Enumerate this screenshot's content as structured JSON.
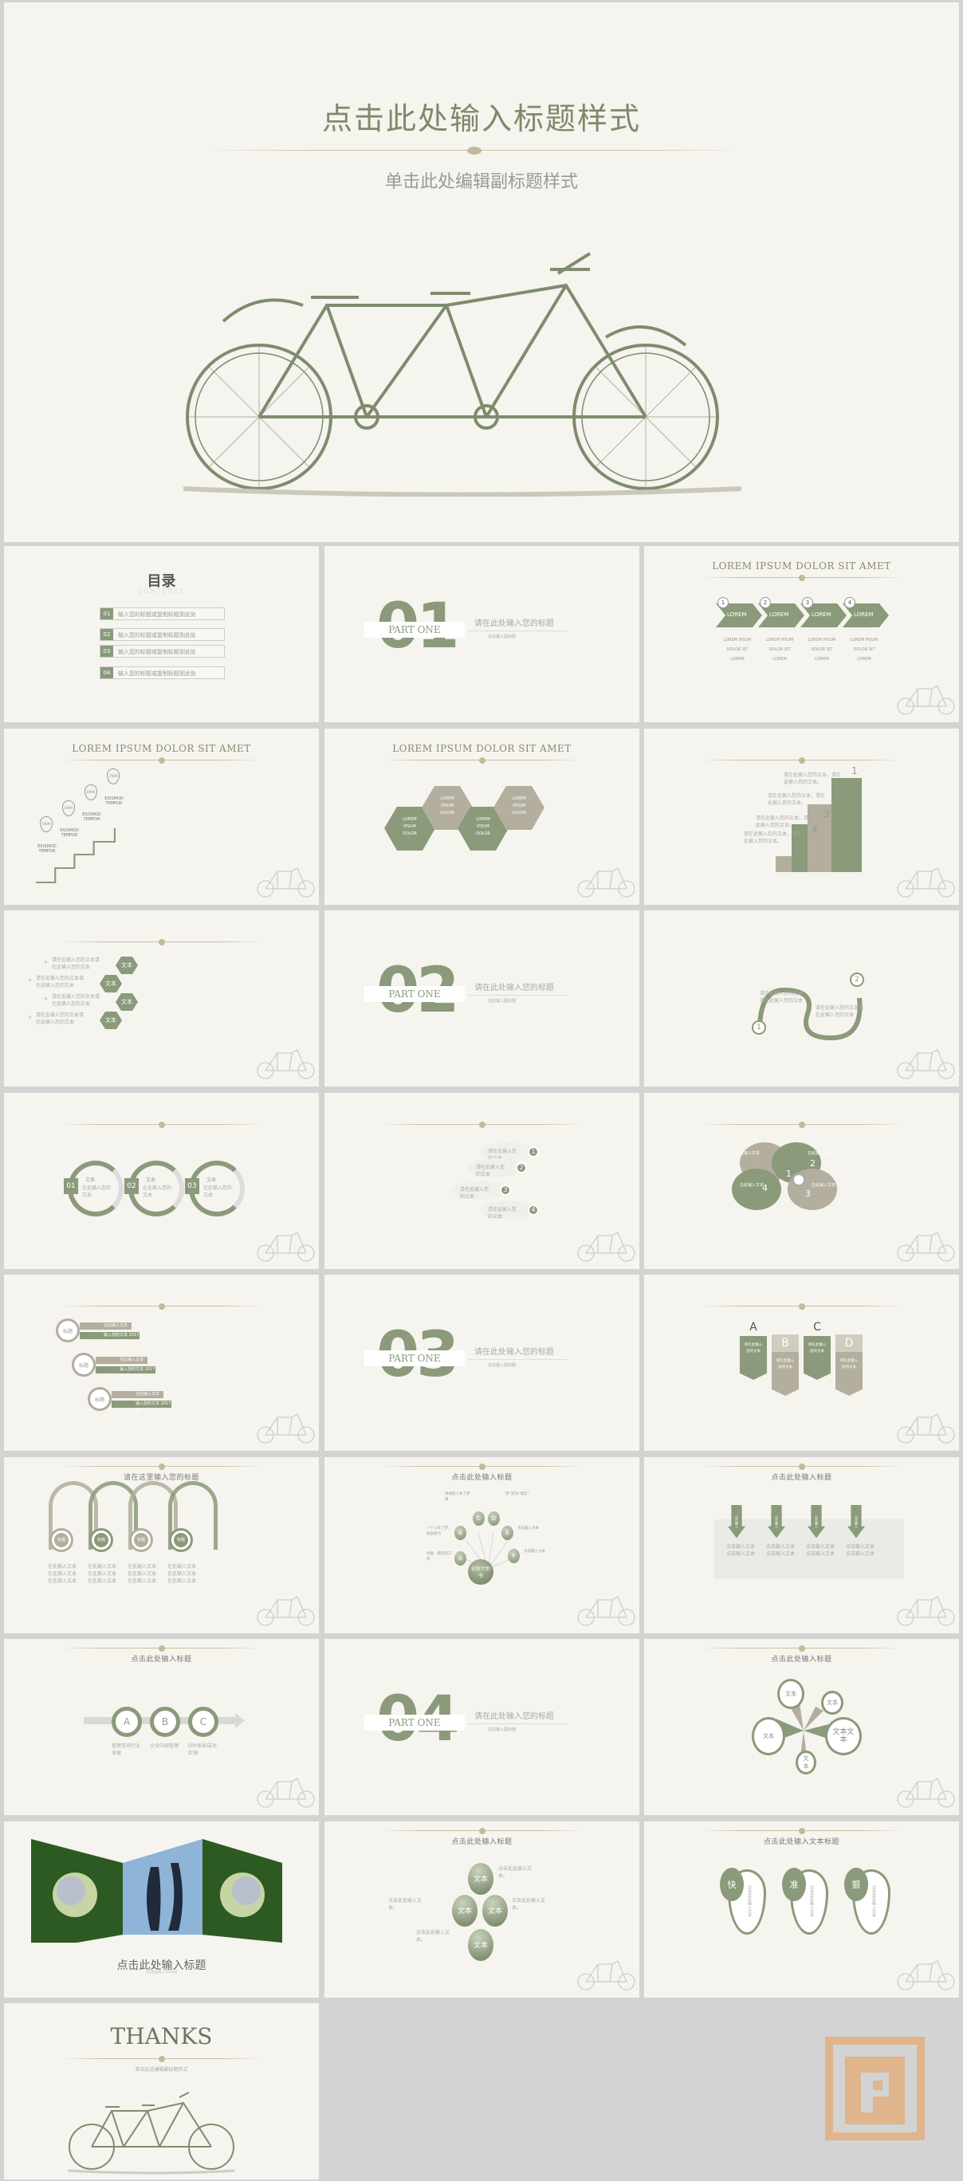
{
  "colors": {
    "green": "#8a9a7a",
    "taupe": "#b3ae9d",
    "bg": "#f6f4ee",
    "page": "#d3d3d3",
    "logo": "#e0b48c"
  },
  "hero": {
    "title": "点击此处输入标题样式",
    "subtitle": "单击此处编辑副标题样式"
  },
  "slides": [
    {
      "type": "toc",
      "title": "目录",
      "subtitle": "CONTENTS",
      "items": [
        {
          "num": "01",
          "text": "输入您的标题或复制标题到此处"
        },
        {
          "num": "02",
          "text": "输入您的标题或复制标题到此处"
        },
        {
          "num": "03",
          "text": "输入您的标题或复制标题到此处"
        },
        {
          "num": "04",
          "text": "输入您的标题或复制标题到此处"
        }
      ]
    },
    {
      "type": "section",
      "num": "01",
      "part": "PART ONE",
      "title": "请在此处输入您的标题",
      "subtitle": "在此输入副标题"
    },
    {
      "type": "chevrons",
      "title": "LOREM IPSUM DOLOR SIT AMET",
      "items": [
        {
          "num": "1",
          "label": "LOREM",
          "caption": [
            "LOREM IPSUM",
            "DOLOR SIT",
            "LOREM"
          ]
        },
        {
          "num": "2",
          "label": "LOREM",
          "caption": [
            "LOREM IPSUM",
            "DOLOR SIT",
            "LOREM"
          ]
        },
        {
          "num": "3",
          "label": "LOREM",
          "caption": [
            "LOREM IPSUM",
            "DOLOR SIT",
            "LOREM"
          ]
        },
        {
          "num": "4",
          "label": "LOREM",
          "caption": [
            "LOREM IPSUM",
            "DOLOR SIT",
            "LOREM"
          ]
        }
      ]
    },
    {
      "type": "stairs",
      "title": "LOREM IPSUM DOLOR SIT AMET",
      "items": [
        {
          "pin": "ENIM",
          "text": "EIUSMOD TEMPOR"
        },
        {
          "pin": "ENIM",
          "text": "EIUSMOD TEMPOR"
        },
        {
          "pin": "ENIM",
          "text": "EIUSMOD TEMPOR"
        },
        {
          "pin": "ENIM",
          "text": "EIUSMOD TEMPOR"
        }
      ]
    },
    {
      "type": "hexes",
      "title": "LOREM IPSUM DOLOR SIT AMET",
      "items": [
        "LOREM IPSUM DOLOR",
        "LOREM IPSUM DOLOR",
        "LOREM IPSUM DOLOR",
        "LOREM IPSUM DOLOR"
      ]
    },
    {
      "type": "hands",
      "items": [
        {
          "num": "1",
          "text": "请在此输入您的文本，请在此输入您的文本。"
        },
        {
          "num": "2",
          "text": "请在此输入您的文本，请在此输入您的文本。"
        },
        {
          "num": "3",
          "text": "请在此输入您的文本，请在此输入您的文本。"
        },
        {
          "num": "4",
          "text": "请在此输入您的文本，请在此输入您的文本。"
        }
      ]
    },
    {
      "type": "hexlist",
      "items": [
        {
          "label": "文本",
          "text": "请在此输入您的文本请在此输入您的文本"
        },
        {
          "label": "文本",
          "text": "请在此输入您的文本请在此输入您的文本"
        },
        {
          "label": "文本",
          "text": "请在此输入您的文本请在此输入您的文本"
        },
        {
          "label": "文本",
          "text": "请在此输入您的文本请在此输入您的文本"
        }
      ]
    },
    {
      "type": "section",
      "num": "02",
      "part": "PART ONE",
      "title": "请在此处输入您的标题",
      "subtitle": "在此输入副标题"
    },
    {
      "type": "curve",
      "items": [
        {
          "num": "1",
          "text": "请在此输入您的文本请在此输入您的文本"
        },
        {
          "num": "2",
          "text": "请在此输入您的文本请在此输入您的文本"
        }
      ]
    },
    {
      "type": "rings",
      "items": [
        {
          "num": "01",
          "label": "文本",
          "text": "在此输入您的文本"
        },
        {
          "num": "02",
          "label": "文本",
          "text": "在此输入您的文本"
        },
        {
          "num": "03",
          "label": "文本",
          "text": "在此输入您的文本"
        }
      ]
    },
    {
      "type": "bubbles",
      "items": [
        {
          "num": "1",
          "text": "请在此输入您的文本"
        },
        {
          "num": "2",
          "text": "请在此输入您的文本"
        },
        {
          "num": "3",
          "text": "请在此输入您的文本"
        },
        {
          "num": "4",
          "text": "请在此输入您的文本"
        }
      ]
    },
    {
      "type": "clover",
      "items": [
        {
          "num": "1",
          "text": "在此输入文本"
        },
        {
          "num": "2",
          "text": "在此输入文本"
        },
        {
          "num": "3",
          "text": "在此输入文本"
        },
        {
          "num": "4",
          "text": "在此输入文本"
        }
      ]
    },
    {
      "type": "pills",
      "items": [
        {
          "label": "标题",
          "a": "在此输入文本",
          "b": "输入您的文本 2017年"
        },
        {
          "label": "标题",
          "a": "在此输入文本",
          "b": "输入您的文本 2017年"
        },
        {
          "label": "标题",
          "a": "在此输入文本",
          "b": "输入您的文本 2017年"
        }
      ]
    },
    {
      "type": "section",
      "num": "03",
      "part": "PART ONE",
      "title": "请在此处输入您的标题",
      "subtitle": "在此输入副标题"
    },
    {
      "type": "ribbons",
      "items": [
        {
          "letter": "A",
          "text": "请在此输入您的文本"
        },
        {
          "letter": "B",
          "text": "请在此输入您的文本"
        },
        {
          "letter": "C",
          "text": "请在此输入您的文本"
        },
        {
          "letter": "D",
          "text": "请在此输入您的文本"
        }
      ]
    },
    {
      "type": "arcs",
      "title": "请在这里输入您的标题",
      "items": [
        {
          "label": "标题",
          "text": [
            "在此输入文本",
            "在此输入文本",
            "在此输入文本"
          ]
        },
        {
          "label": "标题",
          "text": [
            "在此输入文本",
            "在此输入文本",
            "在此输入文本"
          ]
        },
        {
          "label": "标题",
          "text": [
            "在此输入文本",
            "在此输入文本",
            "在此输入文本"
          ]
        },
        {
          "label": "标题",
          "text": [
            "在此输入文本",
            "在此输入文本",
            "在此输入文本"
          ]
        }
      ]
    },
    {
      "type": "radial",
      "title": "点击此处输入标题",
      "center": "创业计划书",
      "items": [
        {
          "letter": "A",
          "text": "优质、稳定的工作"
        },
        {
          "letter": "B",
          "text": "一个人有了梦，就会努力"
        },
        {
          "letter": "C",
          "text": "单纯的人有了梦想"
        },
        {
          "letter": "D",
          "text": "“梦”成为“现实”"
        },
        {
          "letter": "E",
          "text": "点击输入文本"
        },
        {
          "letter": "F",
          "text": "点击输入文本"
        }
      ]
    },
    {
      "type": "downarrows",
      "title": "点击此处输入标题",
      "items": [
        {
          "label": "点击输入",
          "text": "点击输入文本"
        },
        {
          "label": "点击输入",
          "text": "点击输入文本"
        },
        {
          "label": "点击输入",
          "text": "点击输入文本"
        },
        {
          "label": "点击输入",
          "text": "点击输入文本"
        }
      ]
    },
    {
      "type": "abc",
      "title": "点击此处输入标题",
      "items": [
        {
          "letter": "A",
          "text": "管理咨询行业发展"
        },
        {
          "letter": "B",
          "text": "企业内部管理"
        },
        {
          "letter": "C",
          "text": "ERP系统成功实施"
        }
      ]
    },
    {
      "type": "section",
      "num": "04",
      "part": "PART ONE",
      "title": "请在此处输入您的标题",
      "subtitle": "在此输入副标题"
    },
    {
      "type": "petals",
      "title": "点击此处输入标题",
      "items": [
        "文本",
        "文本",
        "文本",
        "文本文本",
        "文本"
      ]
    },
    {
      "type": "photo",
      "title": "点击此处输入标题",
      "subtitle": "点击此处输入文本内容"
    },
    {
      "type": "orbs",
      "title": "点击此处输入标题",
      "items": [
        {
          "label": "文本",
          "text": "点击此处输入文本。"
        },
        {
          "label": "文本",
          "text": "点击此处输入文本。"
        },
        {
          "label": "文本",
          "text": "点击此处输入文本。"
        },
        {
          "label": "文本",
          "text": "点击此处输入文本。"
        }
      ]
    },
    {
      "type": "drops",
      "title": "点击此处输入文本标题",
      "items": [
        {
          "char": "快",
          "text": "点击此处输入文本"
        },
        {
          "char": "准",
          "text": "点击此处输入文本"
        },
        {
          "char": "狠",
          "text": "点击此处输入文本"
        }
      ]
    },
    {
      "type": "thanks",
      "title": "THANKS",
      "subtitle": "单击此处编辑副标题样式"
    }
  ]
}
